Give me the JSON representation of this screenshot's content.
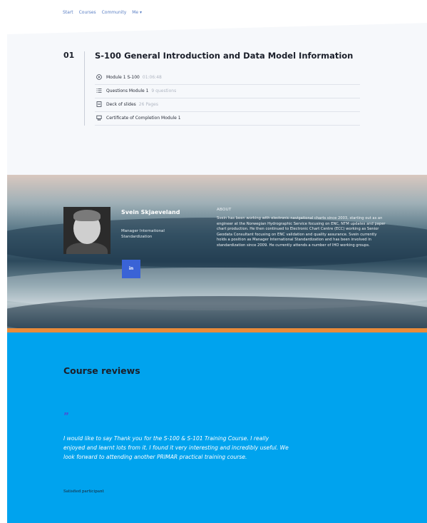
{
  "nav": {
    "items": [
      "Start",
      "Courses",
      "Community",
      "Me ▾"
    ]
  },
  "curriculum": {
    "number": "01",
    "title": "S-100 General Introduction and Data Model Information",
    "items": [
      {
        "icon": "play-circle-icon",
        "label": "Module 1 S-100",
        "meta": "01:06:48"
      },
      {
        "icon": "list-icon",
        "label": "Questions Module 1",
        "meta": "9 questions"
      },
      {
        "icon": "document-icon",
        "label": "Deck of slides",
        "meta": "26 Pages"
      },
      {
        "icon": "certificate-icon",
        "label": "Certificate of Completion Module 1",
        "meta": ""
      }
    ]
  },
  "speaker": {
    "name": "Svein Skjaeveland",
    "role": "Manager International Standardization",
    "linkedin_label": "in",
    "about_heading": "ABOUT",
    "about_text": "Svein has been working with electronic navigational charts since 2003, starting out as an engineer at the Norwegian Hydrographic Service focusing on ENC, NTM updates and paper chart production. He then continued to Electronic Chart Centre (ECC) working as Senior Geodata Consultant focusing on ENC validation and quality assurance. Svein currently holds a position as Manager International Standardization and has been involved in standardization since 2009. He currently attends a number of IHO working groups."
  },
  "reviews": {
    "heading": "Course reviews",
    "quote_mark": "”",
    "text": "I would like to say Thank you for the S-100 & S-101 Training Course. I really enjoyed and learnt lots from it. I found it very interesting and incredibly useful. We look forward to attending another PRIMAR practical training course.",
    "author": "Satisfied participant"
  },
  "colors": {
    "nav_link": "#5a7fc4",
    "accent": "#e98b3a",
    "reviews_bg": "#00a3ee",
    "linkedin": "#3a63d6",
    "quote": "#4a4fd6"
  }
}
